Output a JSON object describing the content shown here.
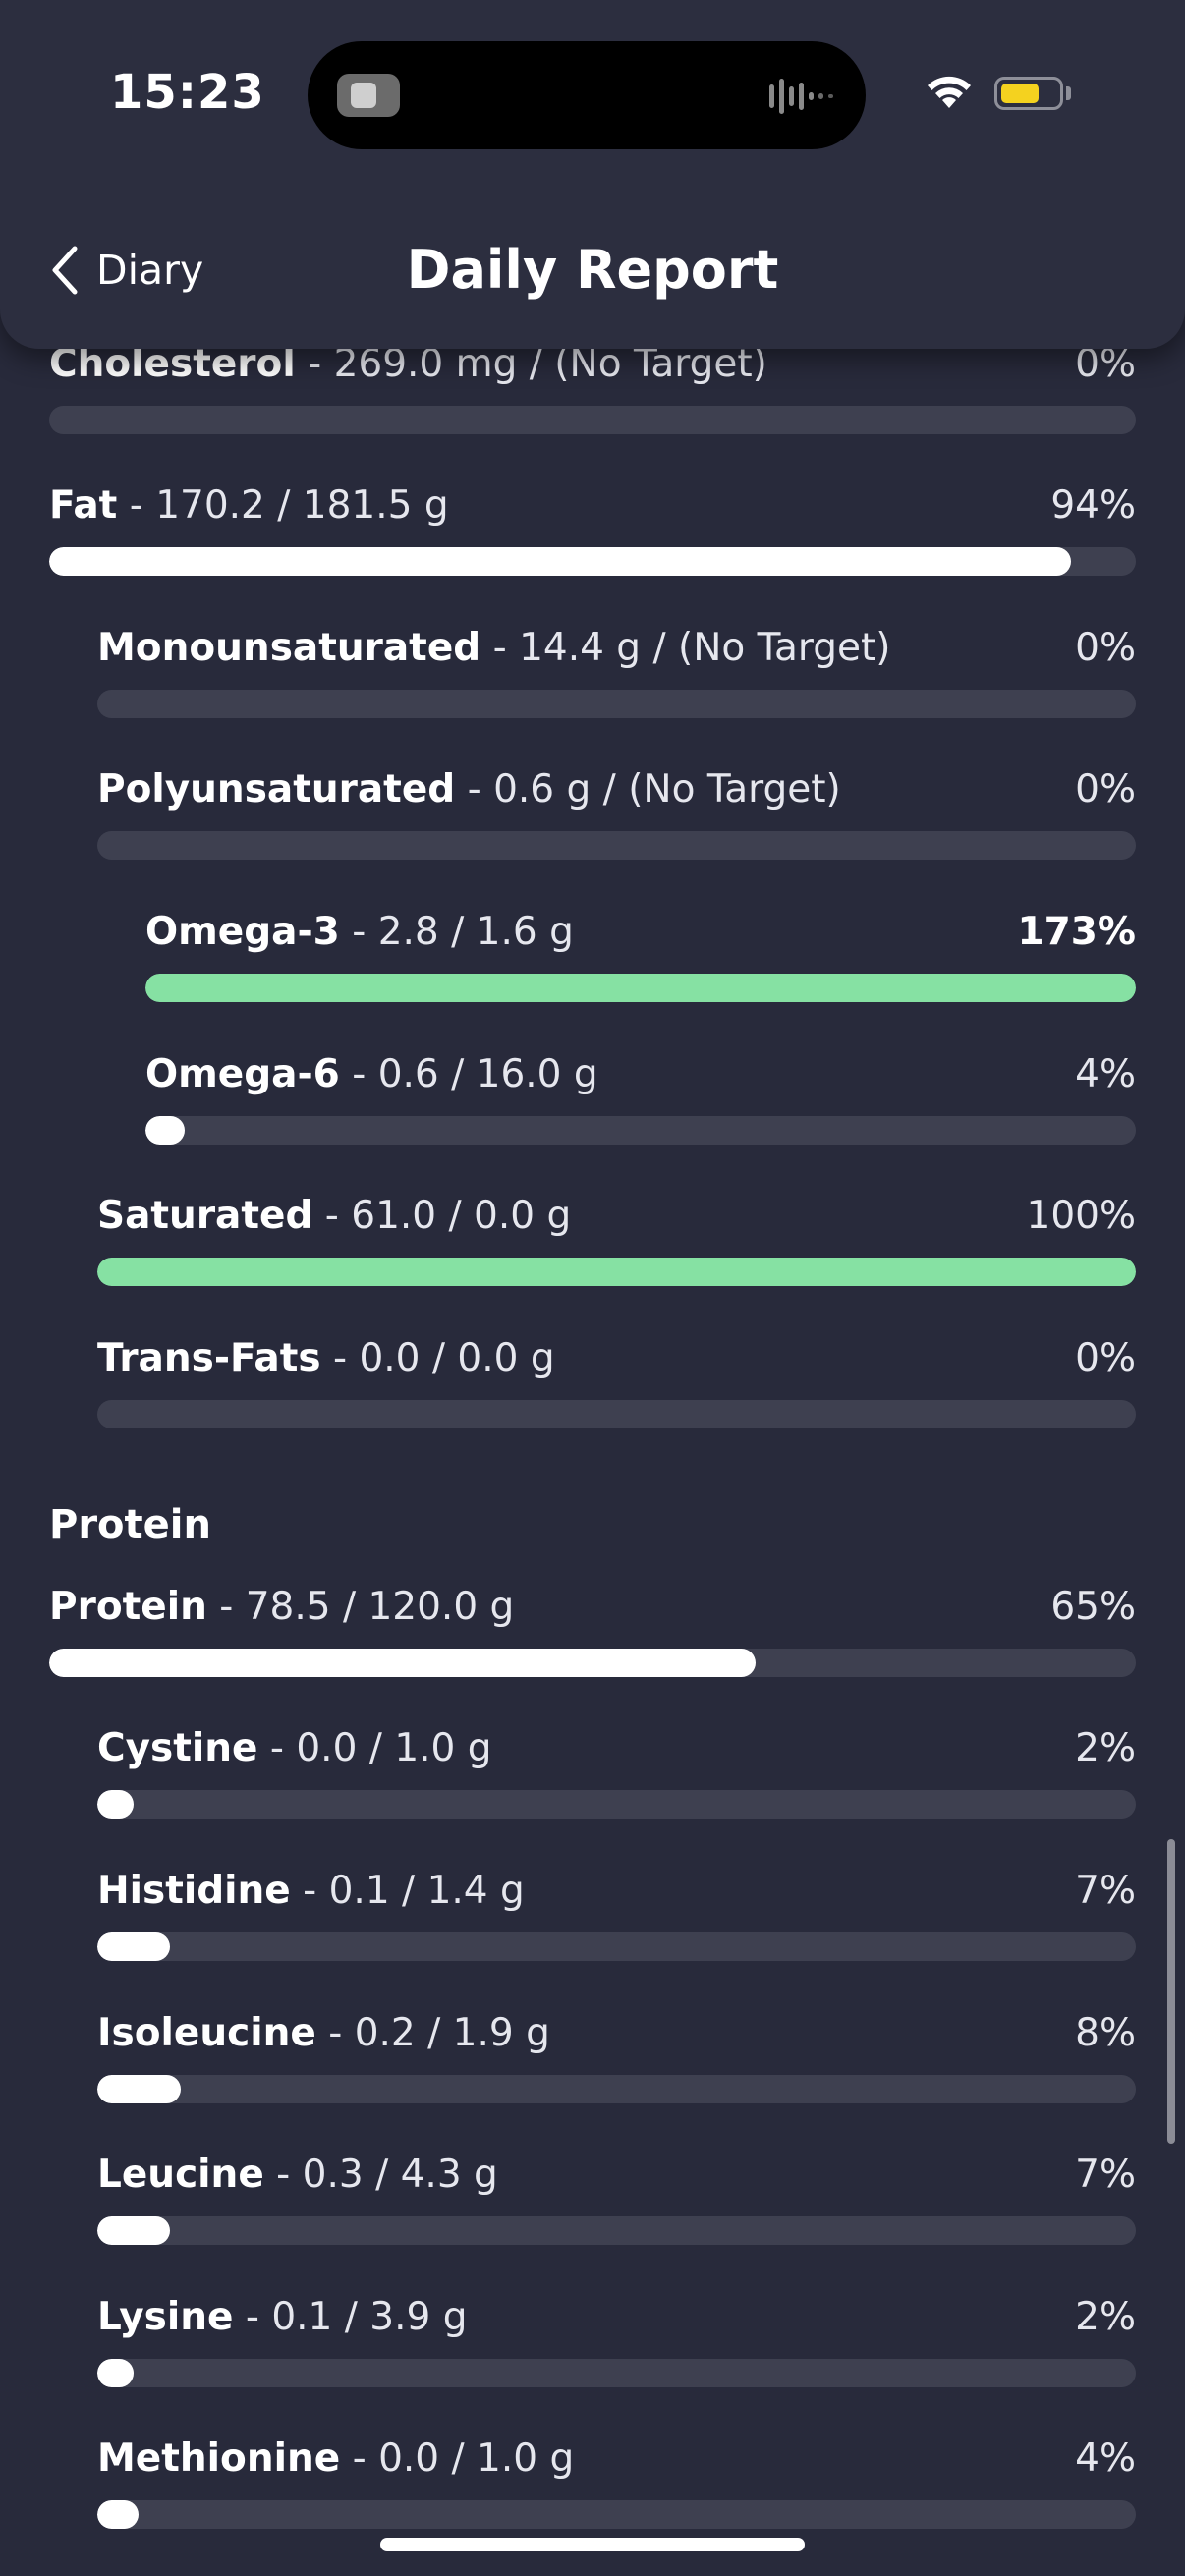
{
  "status_bar": {
    "time": "15:23",
    "battery_color": "#f4d21f"
  },
  "header": {
    "back_label": "Diary",
    "title": "Daily Report"
  },
  "icons": {
    "back": "chevron-left-icon",
    "wifi": "wifi-icon",
    "battery": "battery-icon",
    "audio": "audio-waveform-icon"
  },
  "colors": {
    "background": "#282a3b",
    "track": "#3e4050",
    "fill_default": "#ffffff",
    "fill_complete": "#86e1a3"
  },
  "fat_rows": [
    {
      "name": "Cholesterol",
      "detail": "269.0 mg / (No Target)",
      "percent_label": "0%",
      "progress": 0.0,
      "fill_color": "white",
      "bold_percent": false
    },
    {
      "name": "Fat",
      "detail": "170.2 / 181.5 g",
      "percent_label": "94%",
      "progress": 0.94,
      "fill_color": "white",
      "bold_percent": false
    },
    {
      "name": "Monounsaturated",
      "detail": "14.4 g / (No Target)",
      "percent_label": "0%",
      "progress": 0.0,
      "fill_color": "white",
      "bold_percent": false
    },
    {
      "name": "Polyunsaturated",
      "detail": "0.6 g / (No Target)",
      "percent_label": "0%",
      "progress": 0.0,
      "fill_color": "white",
      "bold_percent": false
    },
    {
      "name": "Omega-3",
      "detail": "2.8 / 1.6 g",
      "percent_label": "173%",
      "progress": 1.0,
      "fill_color": "green",
      "bold_percent": true
    },
    {
      "name": "Omega-6",
      "detail": "0.6 / 16.0 g",
      "percent_label": "4%",
      "progress": 0.04,
      "fill_color": "white",
      "bold_percent": false
    },
    {
      "name": "Saturated",
      "detail": "61.0 / 0.0 g",
      "percent_label": "100%",
      "progress": 1.0,
      "fill_color": "green",
      "bold_percent": false
    },
    {
      "name": "Trans-Fats",
      "detail": "0.0 / 0.0 g",
      "percent_label": "0%",
      "progress": 0.0,
      "fill_color": "white",
      "bold_percent": false
    }
  ],
  "protein_section": {
    "title": "Protein"
  },
  "protein_rows": [
    {
      "name": "Protein",
      "detail": "78.5 / 120.0 g",
      "percent_label": "65%",
      "progress": 0.65,
      "fill_color": "white",
      "bold_percent": false
    },
    {
      "name": "Cystine",
      "detail": "0.0 / 1.0 g",
      "percent_label": "2%",
      "progress": 0.02,
      "fill_color": "white",
      "bold_percent": false
    },
    {
      "name": "Histidine",
      "detail": "0.1 / 1.4 g",
      "percent_label": "7%",
      "progress": 0.07,
      "fill_color": "white",
      "bold_percent": false
    },
    {
      "name": "Isoleucine",
      "detail": "0.2 / 1.9 g",
      "percent_label": "8%",
      "progress": 0.08,
      "fill_color": "white",
      "bold_percent": false
    },
    {
      "name": "Leucine",
      "detail": "0.3 / 4.3 g",
      "percent_label": "7%",
      "progress": 0.07,
      "fill_color": "white",
      "bold_percent": false
    },
    {
      "name": "Lysine",
      "detail": "0.1 / 3.9 g",
      "percent_label": "2%",
      "progress": 0.02,
      "fill_color": "white",
      "bold_percent": false
    },
    {
      "name": "Methionine",
      "detail": "0.0 / 1.0 g",
      "percent_label": "4%",
      "progress": 0.04,
      "fill_color": "white",
      "bold_percent": false
    }
  ]
}
